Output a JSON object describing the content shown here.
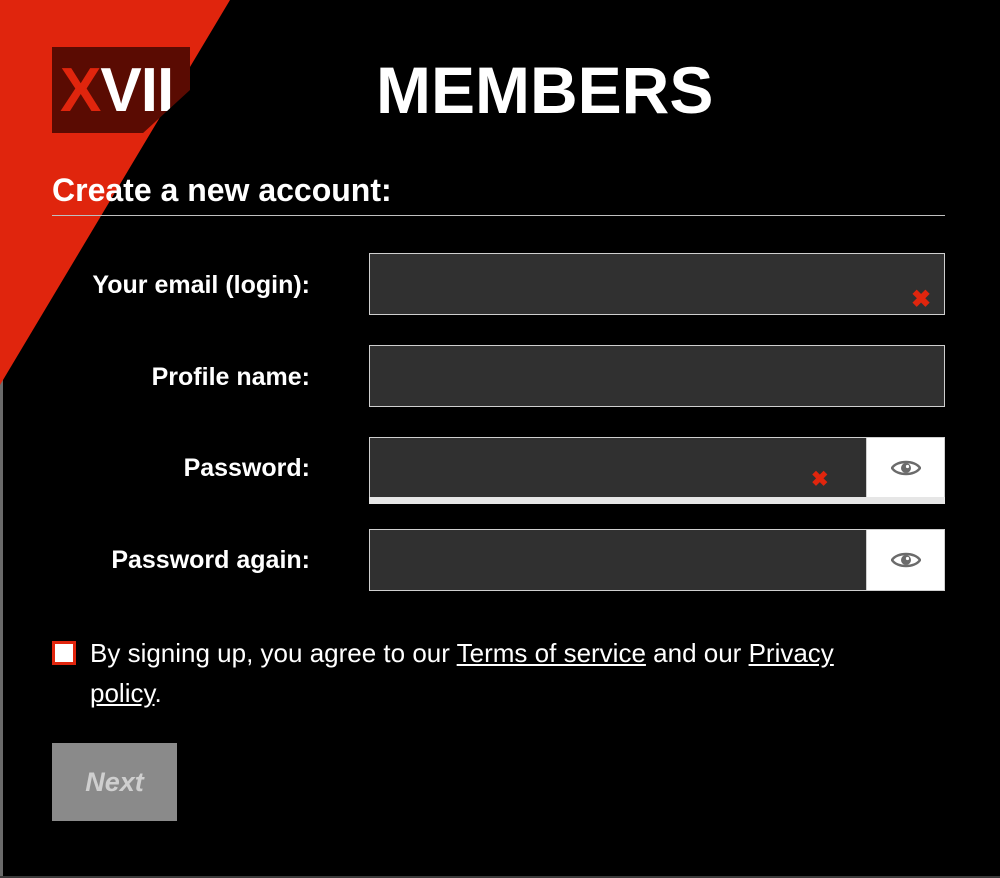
{
  "logo": {
    "letter_x": "X",
    "letters_rest": "VII"
  },
  "header": {
    "title": "MEMBERS"
  },
  "form": {
    "heading": "Create a new account:",
    "email": {
      "label": "Your email (login):",
      "value": "",
      "error_icon": "close-icon"
    },
    "profile_name": {
      "label": "Profile name:",
      "value": ""
    },
    "password": {
      "label": "Password:",
      "value": "",
      "error_icon": "close-icon",
      "toggle_icon": "eye-icon"
    },
    "password_again": {
      "label": "Password again:",
      "value": "",
      "toggle_icon": "eye-icon"
    },
    "terms": {
      "checked": false,
      "prefix": "By signing up, you agree to our ",
      "terms_link": "Terms of service",
      "middle": " and our ",
      "privacy_link": "Privacy policy",
      "suffix": "."
    },
    "next_button": "Next"
  },
  "colors": {
    "accent": "#e0250d",
    "background": "#000000",
    "input_background": "#303030",
    "disabled_button": "#8a8a8a"
  }
}
